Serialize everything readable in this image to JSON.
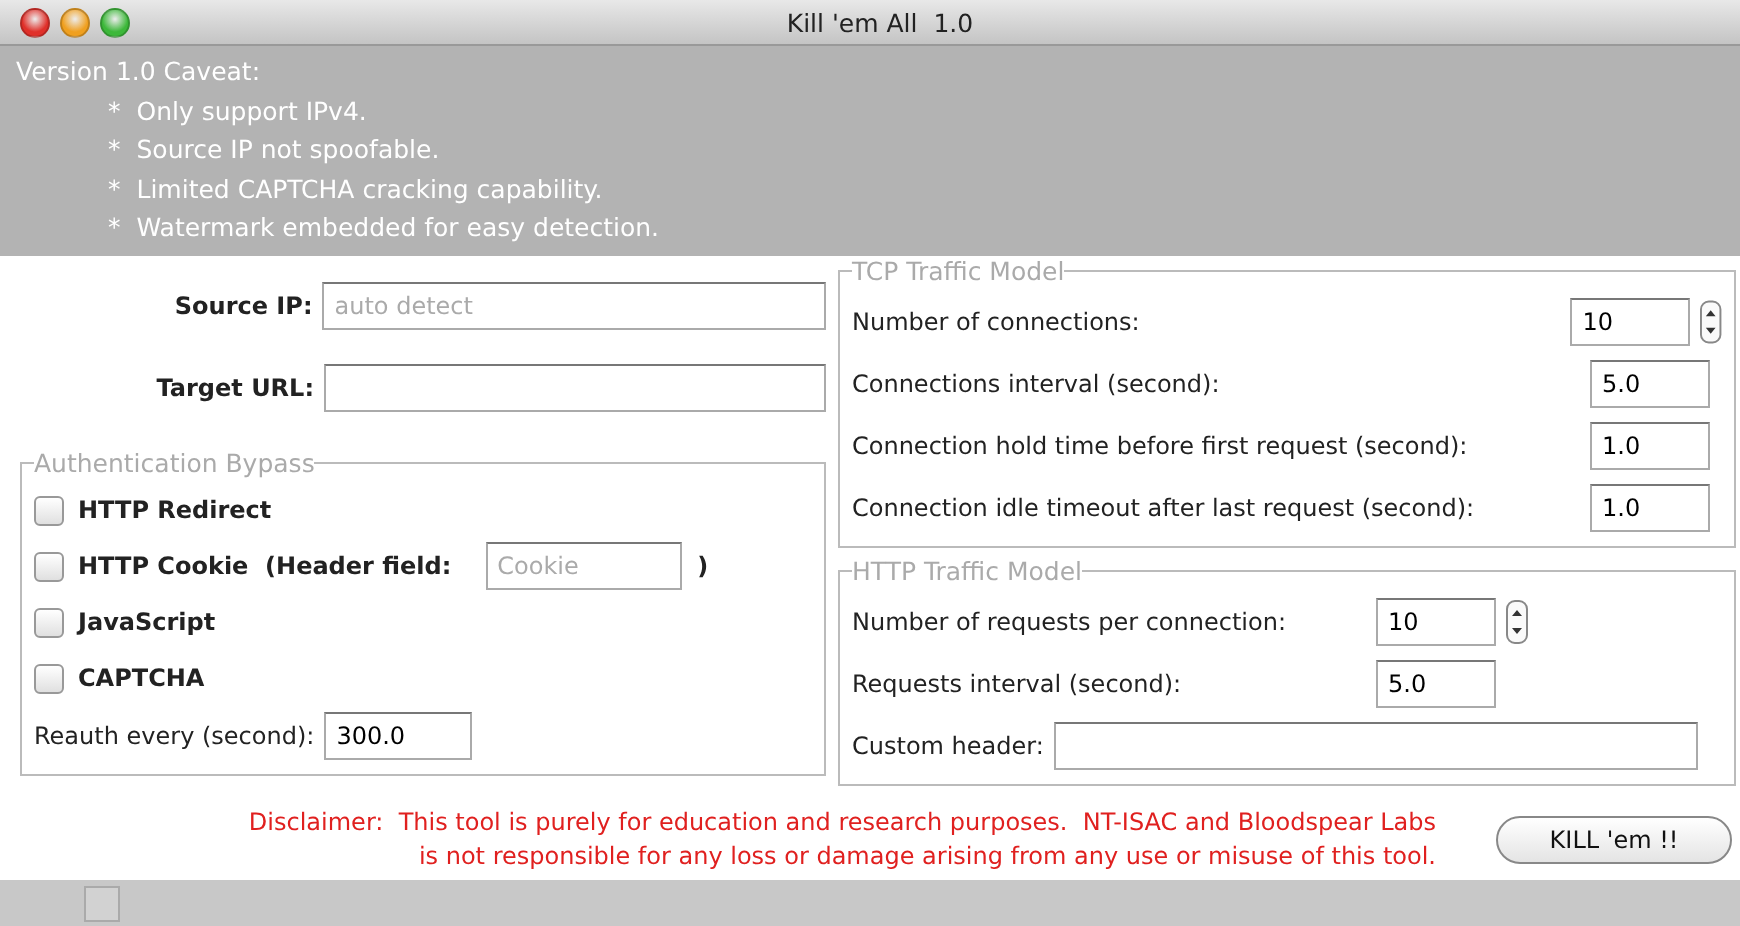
{
  "window": {
    "title": "Kill 'em All  1.0"
  },
  "caveat": {
    "heading": "Version 1.0 Caveat:",
    "bullet": "*",
    "items": [
      "Only support IPv4.",
      "Source IP not spoofable.",
      "Limited CAPTCHA cracking capability.",
      "Watermark embedded for easy detection."
    ]
  },
  "source_ip": {
    "label": "Source IP:",
    "placeholder": "auto detect"
  },
  "target_url": {
    "label": "Target URL:"
  },
  "auth": {
    "title": "Authentication Bypass",
    "options": [
      {
        "kind": "plain",
        "label": "HTTP Redirect",
        "checked": false
      },
      {
        "kind": "field",
        "label": "HTTP Cookie  (Header field:",
        "placeholder": "Cookie",
        "suffix": ")",
        "checked": false
      },
      {
        "kind": "plain",
        "label": "JavaScript",
        "checked": false
      },
      {
        "kind": "plain",
        "label": "CAPTCHA",
        "checked": false
      }
    ],
    "reauth": {
      "label": "Reauth every (second):",
      "value": "300.0"
    }
  },
  "tcp": {
    "title": "TCP Traffic Model",
    "rows": [
      {
        "kind": "spinner",
        "label": "Number of connections:",
        "value": "10"
      },
      {
        "kind": "plain",
        "label": "Connections interval (second):",
        "value": "5.0"
      },
      {
        "kind": "plain",
        "label": "Connection hold time before first request (second):",
        "value": "1.0"
      },
      {
        "kind": "plain",
        "label": "Connection idle timeout after last request (second):",
        "value": "1.0"
      }
    ]
  },
  "http": {
    "title": "HTTP Traffic Model",
    "rows": [
      {
        "kind": "spinner",
        "label": "Number of requests per connection:",
        "value": "10"
      },
      {
        "kind": "plain",
        "label": "Requests interval (second):",
        "value": "5.0"
      },
      {
        "kind": "wide",
        "label": "Custom header:"
      }
    ]
  },
  "disclaimer": {
    "lines": [
      "Disclaimer:  This tool is purely for education and research purposes.  NT-ISAC and Bloodspear Labs",
      "is not responsible for any loss or damage arising from any use or misuse of this tool."
    ]
  },
  "button": "KILL 'em !!"
}
